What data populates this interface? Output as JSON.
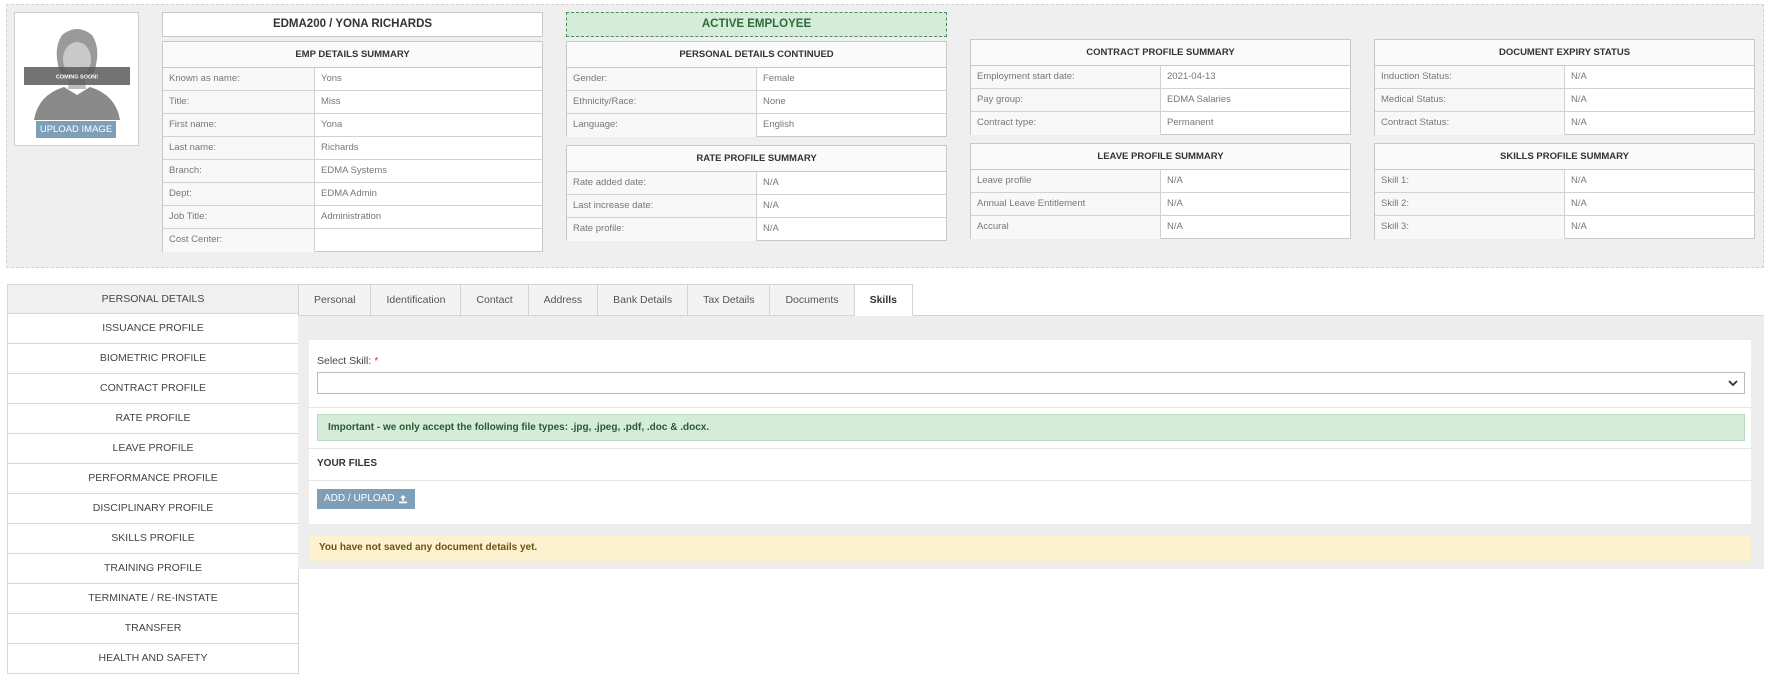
{
  "photo": {
    "placeholder_text": "COMING SOON!",
    "upload_label": "UPLOAD IMAGE"
  },
  "header": {
    "employee": "EDMA200 / YONA RICHARDS",
    "status": "ACTIVE EMPLOYEE"
  },
  "emp_details": {
    "title": "EMP DETAILS SUMMARY",
    "rows": [
      {
        "k": "Known as name:",
        "v": "Yons"
      },
      {
        "k": "Title:",
        "v": "Miss"
      },
      {
        "k": "First name:",
        "v": "Yona"
      },
      {
        "k": "Last name:",
        "v": "Richards"
      },
      {
        "k": "Branch:",
        "v": "EDMA Systems"
      },
      {
        "k": "Dept:",
        "v": "EDMA Admin"
      },
      {
        "k": "Job Title:",
        "v": "Administration"
      },
      {
        "k": "Cost Center:",
        "v": ""
      }
    ]
  },
  "personal_continued": {
    "title": "PERSONAL DETAILS CONTINUED",
    "rows": [
      {
        "k": "Gender:",
        "v": "Female"
      },
      {
        "k": "Ethnicity/Race:",
        "v": "None"
      },
      {
        "k": "Language:",
        "v": "English"
      }
    ]
  },
  "rate_profile": {
    "title": "RATE PROFILE SUMMARY",
    "rows": [
      {
        "k": "Rate added date:",
        "v": "N/A"
      },
      {
        "k": "Last increase date:",
        "v": "N/A"
      },
      {
        "k": "Rate profile:",
        "v": "N/A"
      }
    ]
  },
  "contract_profile": {
    "title": "CONTRACT PROFILE SUMMARY",
    "rows": [
      {
        "k": "Employment start date:",
        "v": "2021-04-13"
      },
      {
        "k": "Pay group:",
        "v": "EDMA Salaries"
      },
      {
        "k": "Contract type:",
        "v": "Permanent"
      }
    ]
  },
  "leave_profile": {
    "title": "LEAVE PROFILE SUMMARY",
    "rows": [
      {
        "k": "Leave profile",
        "v": "N/A"
      },
      {
        "k": "Annual Leave Entitlement",
        "v": "N/A"
      },
      {
        "k": "Accural",
        "v": "N/A"
      }
    ]
  },
  "document_expiry": {
    "title": "DOCUMENT EXPIRY STATUS",
    "rows": [
      {
        "k": "Induction Status:",
        "v": "N/A"
      },
      {
        "k": "Medical Status:",
        "v": "N/A"
      },
      {
        "k": "Contract Status:",
        "v": "N/A"
      }
    ]
  },
  "skills_profile": {
    "title": "SKILLS PROFILE SUMMARY",
    "rows": [
      {
        "k": "Skill 1:",
        "v": "N/A"
      },
      {
        "k": "Skill 2:",
        "v": "N/A"
      },
      {
        "k": "Skill 3:",
        "v": "N/A"
      }
    ]
  },
  "side_nav": [
    "PERSONAL DETAILS",
    "ISSUANCE PROFILE",
    "BIOMETRIC PROFILE",
    "CONTRACT PROFILE",
    "RATE PROFILE",
    "LEAVE PROFILE",
    "PERFORMANCE PROFILE",
    "DISCIPLINARY PROFILE",
    "SKILLS PROFILE",
    "TRAINING PROFILE",
    "TERMINATE / RE-INSTATE",
    "TRANSFER",
    "HEALTH AND SAFETY"
  ],
  "tabs": [
    "Personal",
    "Identification",
    "Contact",
    "Address",
    "Bank Details",
    "Tax Details",
    "Documents",
    "Skills"
  ],
  "active_tab": "Skills",
  "skills_form": {
    "select_label": "Select Skill:",
    "required_mark": "*",
    "selected_value": "",
    "file_notice": "Important - we only accept the following file types: .jpg, .jpeg, .pdf, .doc & .docx.",
    "files_title": "YOUR FILES",
    "add_button": "ADD / UPLOAD",
    "empty_message": "You have not saved any document details yet."
  },
  "colors": {
    "accent_button": "#7e9fb8",
    "active_badge_bg": "#d4ecd9",
    "active_badge_text": "#2f6b3a",
    "notice_green_bg": "#d5ecd9",
    "notice_yellow_bg": "#fcf2cf",
    "required": "#dd3333"
  }
}
